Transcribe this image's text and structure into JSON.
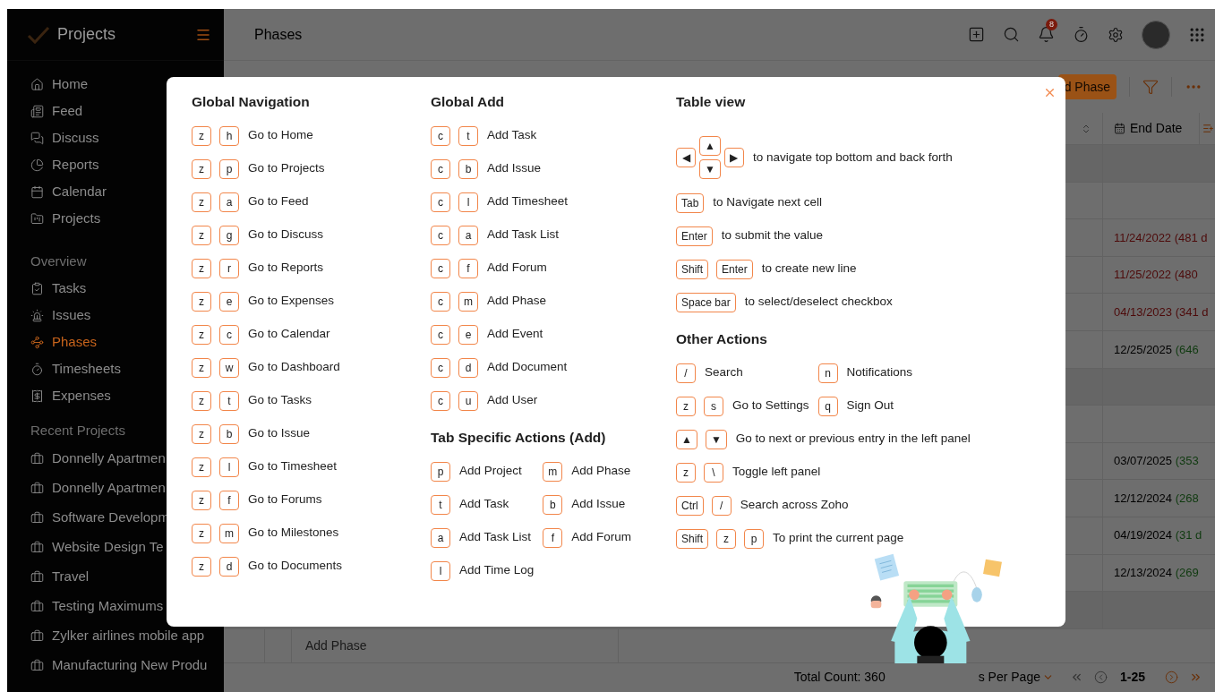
{
  "sidebar": {
    "app_title": "Projects",
    "main_items": [
      {
        "label": "Home",
        "selected": false
      },
      {
        "label": "Feed",
        "selected": false
      },
      {
        "label": "Discuss",
        "selected": false
      },
      {
        "label": "Reports",
        "selected": false
      },
      {
        "label": "Calendar",
        "selected": false
      },
      {
        "label": "Projects",
        "selected": false
      }
    ],
    "overview_heading": "Overview",
    "overview_items": [
      {
        "label": "Tasks",
        "selected": false
      },
      {
        "label": "Issues",
        "selected": false
      },
      {
        "label": "Phases",
        "selected": true
      },
      {
        "label": "Timesheets",
        "selected": false
      },
      {
        "label": "Expenses",
        "selected": false
      }
    ],
    "recent_heading": "Recent Projects",
    "recent_projects": [
      "Donnelly Apartmen",
      "Donnelly Apartmen",
      "Software Developm",
      "Website Design Te",
      "Travel",
      "Testing Maximums",
      "Zylker airlines mobile app",
      "Manufacturing New Produ"
    ]
  },
  "topbar": {
    "title": "Phases",
    "notification_count": "8"
  },
  "toolbar": {
    "add_button": "d Phase"
  },
  "table": {
    "column": "End Date",
    "rows": [
      {
        "kind": "group"
      },
      {
        "kind": "blank"
      },
      {
        "kind": "date",
        "end_date": "11/24/2022",
        "days": "(481 d",
        "overdue": true,
        "color": "#4d0a0a"
      },
      {
        "kind": "date",
        "end_date": "11/25/2022",
        "days": "(480",
        "overdue": true,
        "color": "#4d0a0a"
      },
      {
        "kind": "date",
        "end_date": "04/13/2023",
        "days": "(341 d",
        "overdue": true,
        "color": "#4d0a0a"
      },
      {
        "kind": "date",
        "end_date": "12/25/2025",
        "days": "(646",
        "overdue": false,
        "color": "#0f3a0f"
      },
      {
        "kind": "group"
      },
      {
        "kind": "blank"
      },
      {
        "kind": "date",
        "end_date": "03/07/2025",
        "days": "(353",
        "overdue": false,
        "color": "#0f3a0f"
      },
      {
        "kind": "date",
        "end_date": "12/12/2024",
        "days": "(268",
        "overdue": false,
        "color": "#0f3a0f"
      },
      {
        "kind": "date",
        "end_date": "04/19/2024",
        "days": "(31 d",
        "overdue": false,
        "color": "#0f3a0f"
      },
      {
        "kind": "date",
        "end_date": "12/13/2024",
        "days": "(269",
        "overdue": false,
        "color": "#0f3a0f"
      },
      {
        "kind": "group"
      }
    ],
    "add_row": "Add Phase"
  },
  "footer": {
    "total": "Total Count: 360",
    "per_page": "s Per Page",
    "range": "1-25"
  },
  "shortcuts_dialog": {
    "columns": [
      {
        "sections": [
          {
            "heading": "Global Navigation",
            "items": [
              {
                "kind": "full",
                "keys": [
                  "z",
                  "h"
                ],
                "label": "Go to Home"
              },
              {
                "kind": "full",
                "keys": [
                  "z",
                  "p"
                ],
                "label": "Go to Projects"
              },
              {
                "kind": "full",
                "keys": [
                  "z",
                  "a"
                ],
                "label": "Go to Feed"
              },
              {
                "kind": "full",
                "keys": [
                  "z",
                  "g"
                ],
                "label": "Go to Discuss"
              },
              {
                "kind": "full",
                "keys": [
                  "z",
                  "r"
                ],
                "label": "Go to Reports"
              },
              {
                "kind": "full",
                "keys": [
                  "z",
                  "e"
                ],
                "label": "Go to Expenses"
              },
              {
                "kind": "full",
                "keys": [
                  "z",
                  "c"
                ],
                "label": "Go to Calendar"
              },
              {
                "kind": "full",
                "keys": [
                  "z",
                  "w"
                ],
                "label": "Go to Dashboard"
              },
              {
                "kind": "full",
                "keys": [
                  "z",
                  "t"
                ],
                "label": "Go to Tasks"
              },
              {
                "kind": "full",
                "keys": [
                  "z",
                  "b"
                ],
                "label": "Go to Issue"
              },
              {
                "kind": "full",
                "keys": [
                  "z",
                  "l"
                ],
                "label": "Go to Timesheet"
              },
              {
                "kind": "full",
                "keys": [
                  "z",
                  "f"
                ],
                "label": "Go to Forums"
              },
              {
                "kind": "full",
                "keys": [
                  "z",
                  "m"
                ],
                "label": "Go to Milestones"
              },
              {
                "kind": "full",
                "keys": [
                  "z",
                  "d"
                ],
                "label": "Go to Documents"
              }
            ]
          }
        ]
      },
      {
        "sections": [
          {
            "heading": "Global Add",
            "items": [
              {
                "kind": "full",
                "keys": [
                  "c",
                  "t"
                ],
                "label": "Add Task"
              },
              {
                "kind": "full",
                "keys": [
                  "c",
                  "b"
                ],
                "label": "Add Issue"
              },
              {
                "kind": "full",
                "keys": [
                  "c",
                  "l"
                ],
                "label": "Add Timesheet"
              },
              {
                "kind": "full",
                "keys": [
                  "c",
                  "a"
                ],
                "label": "Add Task List"
              },
              {
                "kind": "full",
                "keys": [
                  "c",
                  "f"
                ],
                "label": "Add Forum"
              },
              {
                "kind": "full",
                "keys": [
                  "c",
                  "m"
                ],
                "label": "Add Phase"
              },
              {
                "kind": "full",
                "keys": [
                  "c",
                  "e"
                ],
                "label": "Add Event"
              },
              {
                "kind": "full",
                "keys": [
                  "c",
                  "d"
                ],
                "label": "Add Document"
              },
              {
                "kind": "full",
                "keys": [
                  "c",
                  "u"
                ],
                "label": "Add User"
              }
            ]
          },
          {
            "heading": "Tab Specific Actions (Add)",
            "items": [
              {
                "kind": "half",
                "keys": [
                  "p"
                ],
                "label": "Add Project"
              },
              {
                "kind": "half",
                "keys": [
                  "m"
                ],
                "label": "Add Phase"
              },
              {
                "kind": "half",
                "keys": [
                  "t"
                ],
                "label": "Add Task"
              },
              {
                "kind": "half",
                "keys": [
                  "b"
                ],
                "label": "Add Issue"
              },
              {
                "kind": "half",
                "keys": [
                  "a"
                ],
                "label": "Add Task List"
              },
              {
                "kind": "half",
                "keys": [
                  "f"
                ],
                "label": "Add Forum"
              },
              {
                "kind": "half",
                "keys": [
                  "l"
                ],
                "label": "Add Time Log"
              }
            ]
          }
        ]
      },
      {
        "sections": [
          {
            "heading": "Table view",
            "items": [
              {
                "kind": "arrows",
                "keys": [
                  "◀",
                  "▲",
                  "▼",
                  "▶"
                ],
                "label": "to navigate top bottom and back forth"
              },
              {
                "kind": "full",
                "keys": [
                  "Tab"
                ],
                "label": "to Navigate next cell"
              },
              {
                "kind": "full",
                "keys": [
                  "Enter"
                ],
                "label": "to submit the value"
              },
              {
                "kind": "full",
                "keys": [
                  "Shift",
                  "Enter"
                ],
                "label": "to create new line"
              },
              {
                "kind": "full",
                "keys": [
                  "Space bar"
                ],
                "label": "to select/deselect checkbox"
              }
            ]
          },
          {
            "heading": "Other Actions",
            "items": [
              {
                "kind": "half",
                "keys": [
                  "/"
                ],
                "label": "Search"
              },
              {
                "kind": "half",
                "keys": [
                  "n"
                ],
                "label": "Notifications"
              },
              {
                "kind": "half",
                "keys": [
                  "z",
                  "s"
                ],
                "label": "Go to Settings"
              },
              {
                "kind": "half",
                "keys": [
                  "q"
                ],
                "label": "Sign Out"
              },
              {
                "kind": "full",
                "keys": [
                  "▲",
                  "▼"
                ],
                "label": "Go to next or previous entry in the left panel"
              },
              {
                "kind": "full",
                "keys": [
                  "z",
                  "\\"
                ],
                "label": "Toggle left panel"
              },
              {
                "kind": "full",
                "keys": [
                  "Ctrl",
                  "/"
                ],
                "label": "Search across Zoho"
              },
              {
                "kind": "full",
                "keys": [
                  "Shift",
                  "z",
                  "p"
                ],
                "label": "To print the current page"
              }
            ]
          }
        ]
      }
    ]
  }
}
